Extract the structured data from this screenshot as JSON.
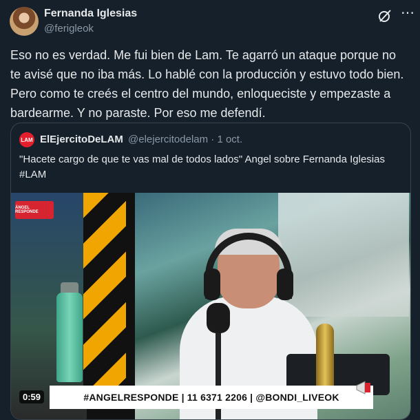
{
  "author": {
    "name": "Fernanda Iglesias",
    "handle": "@ferigleok"
  },
  "tweet": {
    "text": "Eso no es verdad. Me fui bien de Lam. Te agarró un ataque porque no te avisé que no iba más. Lo hablé con la producción y estuvo todo bien. Pero como te creés el centro del mundo, enloqueciste y empezaste a bardearme. Y no paraste. Por eso me defendí."
  },
  "quote": {
    "logo_text": "LAM",
    "name": "ElEjercitoDeLAM",
    "meta": "@elejercitodelam · 1 oct.",
    "text_line1": "\"Hacete cargo de que te vas mal de todos lados\" Angel sobre Fernanda Iglesias",
    "text_line2": "#LAM"
  },
  "video": {
    "live_badge": "ÁNGEL RESPONDE",
    "banner": "#ANGELRESPONDE | 11 6371 2206 | @BONDI_LIVEOK",
    "duration": "0:59"
  },
  "icons": {
    "grok": "grok-icon",
    "more": "more-icon"
  },
  "colors": {
    "background": "#15202b",
    "text": "#e7e9ea",
    "secondary": "#8b98a5",
    "border": "#38444d",
    "brand_red": "#e41e2d"
  }
}
